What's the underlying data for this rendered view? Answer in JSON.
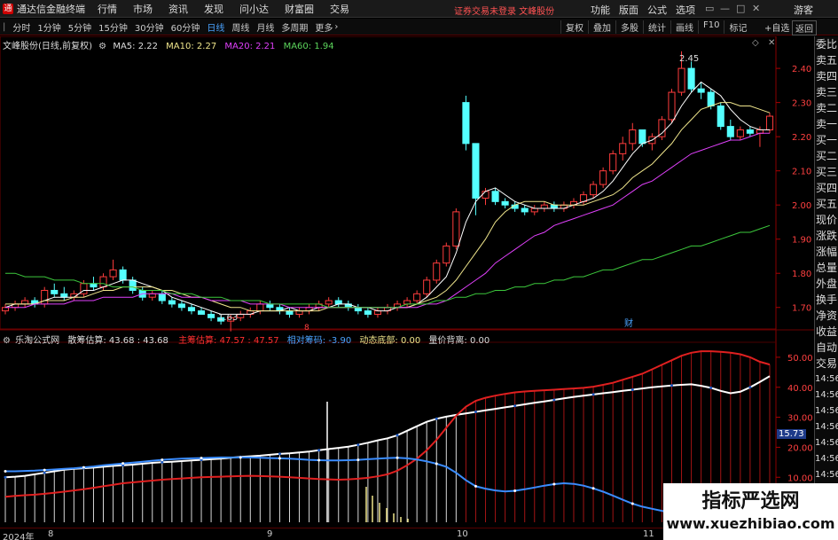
{
  "menubar": {
    "app_title": "通达信金融终端",
    "items": [
      "行情",
      "市场",
      "资讯",
      "发现",
      "问小达",
      "财富圈",
      "交易"
    ],
    "notice": "证券交易未登录  文峰股份",
    "right_items": [
      "功能",
      "版面",
      "公式",
      "选项"
    ],
    "guest": "游客"
  },
  "toolbar": {
    "timeframes": [
      "分时",
      "1分钟",
      "5分钟",
      "15分钟",
      "30分钟",
      "60分钟",
      "日线",
      "周线",
      "月线",
      "多周期",
      "更多"
    ],
    "active": "日线",
    "tools": [
      "复权",
      "叠加",
      "多股",
      "统计",
      "画线",
      "F10",
      "标记"
    ],
    "autoselect": "+自选",
    "back": "返回"
  },
  "main_info": {
    "stock": "文峰股份(日线,前复权)",
    "ma5": "MA5: 2.22",
    "ma10": "MA10: 2.27",
    "ma20": "MA20: 2.21",
    "ma60": "MA60: 1.94"
  },
  "main_annotations": {
    "high": "2.45",
    "low": "1.63",
    "event_8": "8",
    "event_cai": "财"
  },
  "indicator_info": {
    "name": "乐淘公式网",
    "retail_label": "散筹估算: 43.68 : 43.68",
    "main_label": "主筹估算: 47.57 : 47.57",
    "relative_label": "相对筹码: -3.90",
    "bottom_label": "动态底部: 0.00",
    "divergence_label": "量价背离: 0.00"
  },
  "indicator_marker": "15.73",
  "right_panel": [
    "委比",
    "卖五",
    "卖四",
    "卖三",
    "卖二",
    "卖一",
    "买一",
    "买二",
    "买三",
    "买四",
    "买五",
    "现价",
    "涨跌",
    "涨幅",
    "总量",
    "外盘",
    "换手",
    "净资",
    "收益",
    "自动",
    "交易",
    "14:56",
    "14:56",
    "14:56",
    "14:56",
    "14:56",
    "14:56",
    "14:56"
  ],
  "timeline": {
    "year": "2024年",
    "months": [
      "8",
      "9",
      "10",
      "11"
    ]
  },
  "watermark": {
    "title": "指标严选网",
    "url": "www.xuezhibiao.com"
  },
  "chart_data": [
    {
      "type": "candlestick",
      "title": "",
      "y_ticks": [
        "2.40",
        "2.30",
        "2.20",
        "2.10",
        "2.00",
        "1.90",
        "1.80",
        "1.70"
      ],
      "ylim": [
        1.65,
        2.46
      ],
      "ohlc": [
        [
          1.69,
          1.71,
          1.68,
          1.7
        ],
        [
          1.7,
          1.72,
          1.69,
          1.71
        ],
        [
          1.71,
          1.73,
          1.7,
          1.72
        ],
        [
          1.72,
          1.73,
          1.7,
          1.71
        ],
        [
          1.71,
          1.76,
          1.7,
          1.75
        ],
        [
          1.75,
          1.77,
          1.73,
          1.74
        ],
        [
          1.74,
          1.76,
          1.72,
          1.73
        ],
        [
          1.73,
          1.75,
          1.72,
          1.74
        ],
        [
          1.74,
          1.78,
          1.73,
          1.77
        ],
        [
          1.77,
          1.79,
          1.75,
          1.76
        ],
        [
          1.76,
          1.8,
          1.75,
          1.79
        ],
        [
          1.79,
          1.84,
          1.78,
          1.81
        ],
        [
          1.81,
          1.82,
          1.77,
          1.78
        ],
        [
          1.78,
          1.79,
          1.74,
          1.75
        ],
        [
          1.75,
          1.76,
          1.72,
          1.73
        ],
        [
          1.73,
          1.75,
          1.72,
          1.74
        ],
        [
          1.74,
          1.75,
          1.71,
          1.72
        ],
        [
          1.72,
          1.73,
          1.7,
          1.71
        ],
        [
          1.71,
          1.72,
          1.69,
          1.7
        ],
        [
          1.7,
          1.71,
          1.68,
          1.69
        ],
        [
          1.69,
          1.7,
          1.68,
          1.68
        ],
        [
          1.68,
          1.69,
          1.66,
          1.67
        ],
        [
          1.67,
          1.68,
          1.65,
          1.66
        ],
        [
          1.66,
          1.68,
          1.63,
          1.67
        ],
        [
          1.67,
          1.69,
          1.66,
          1.68
        ],
        [
          1.68,
          1.7,
          1.67,
          1.69
        ],
        [
          1.69,
          1.72,
          1.68,
          1.71
        ],
        [
          1.71,
          1.72,
          1.69,
          1.7
        ],
        [
          1.7,
          1.71,
          1.68,
          1.69
        ],
        [
          1.69,
          1.7,
          1.67,
          1.68
        ],
        [
          1.68,
          1.7,
          1.67,
          1.69
        ],
        [
          1.69,
          1.71,
          1.68,
          1.7
        ],
        [
          1.7,
          1.72,
          1.69,
          1.71
        ],
        [
          1.71,
          1.73,
          1.7,
          1.72
        ],
        [
          1.72,
          1.73,
          1.7,
          1.71
        ],
        [
          1.71,
          1.72,
          1.69,
          1.7
        ],
        [
          1.7,
          1.71,
          1.68,
          1.69
        ],
        [
          1.69,
          1.7,
          1.67,
          1.68
        ],
        [
          1.68,
          1.7,
          1.67,
          1.69
        ],
        [
          1.69,
          1.71,
          1.68,
          1.7
        ],
        [
          1.7,
          1.72,
          1.69,
          1.71
        ],
        [
          1.71,
          1.73,
          1.7,
          1.72
        ],
        [
          1.72,
          1.75,
          1.71,
          1.74
        ],
        [
          1.74,
          1.79,
          1.73,
          1.78
        ],
        [
          1.78,
          1.84,
          1.77,
          1.83
        ],
        [
          1.83,
          1.89,
          1.82,
          1.88
        ],
        [
          1.88,
          1.99,
          1.87,
          1.98
        ],
        [
          2.3,
          2.32,
          2.16,
          2.18
        ],
        [
          2.18,
          2.06,
          1.97,
          2.02
        ],
        [
          2.02,
          2.05,
          2.0,
          2.04
        ],
        [
          2.04,
          2.05,
          2.0,
          2.01
        ],
        [
          2.01,
          2.02,
          1.99,
          2.0
        ],
        [
          2.0,
          2.01,
          1.98,
          1.99
        ],
        [
          1.99,
          2.0,
          1.97,
          1.98
        ],
        [
          1.98,
          2.0,
          1.97,
          1.99
        ],
        [
          1.99,
          2.01,
          1.98,
          2.0
        ],
        [
          2.0,
          2.01,
          1.98,
          1.99
        ],
        [
          1.99,
          2.01,
          1.98,
          2.0
        ],
        [
          2.0,
          2.02,
          1.99,
          2.01
        ],
        [
          2.01,
          2.04,
          2.0,
          2.03
        ],
        [
          2.03,
          2.07,
          2.02,
          2.06
        ],
        [
          2.06,
          2.11,
          2.05,
          2.1
        ],
        [
          2.1,
          2.16,
          2.09,
          2.15
        ],
        [
          2.15,
          2.2,
          2.13,
          2.18
        ],
        [
          2.18,
          2.24,
          2.16,
          2.22
        ],
        [
          2.22,
          2.2,
          2.17,
          2.18
        ],
        [
          2.18,
          2.21,
          2.16,
          2.2
        ],
        [
          2.2,
          2.26,
          2.19,
          2.25
        ],
        [
          2.25,
          2.34,
          2.24,
          2.33
        ],
        [
          2.33,
          2.45,
          2.32,
          2.4
        ],
        [
          2.4,
          2.42,
          2.33,
          2.34
        ],
        [
          2.34,
          2.36,
          2.31,
          2.33
        ],
        [
          2.33,
          2.34,
          2.28,
          2.29
        ],
        [
          2.29,
          2.3,
          2.22,
          2.23
        ],
        [
          2.23,
          2.25,
          2.19,
          2.2
        ],
        [
          2.2,
          2.23,
          2.19,
          2.22
        ],
        [
          2.22,
          2.23,
          2.2,
          2.21
        ],
        [
          2.21,
          2.23,
          2.17,
          2.22
        ],
        [
          2.22,
          2.27,
          2.21,
          2.26
        ]
      ],
      "series": [
        {
          "name": "MA5",
          "values": [
            1.7,
            1.71,
            1.71,
            1.71,
            1.72,
            1.73,
            1.73,
            1.73,
            1.75,
            1.75,
            1.76,
            1.77,
            1.78,
            1.78,
            1.77,
            1.76,
            1.75,
            1.73,
            1.72,
            1.71,
            1.7,
            1.69,
            1.68,
            1.68,
            1.68,
            1.68,
            1.69,
            1.69,
            1.69,
            1.7,
            1.69,
            1.69,
            1.7,
            1.7,
            1.71,
            1.71,
            1.7,
            1.7,
            1.69,
            1.69,
            1.7,
            1.7,
            1.71,
            1.73,
            1.76,
            1.79,
            1.86,
            1.95,
            2.01,
            2.04,
            2.05,
            2.03,
            2.01,
            2.0,
            1.99,
            1.99,
            1.99,
            1.99,
            2.0,
            2.01,
            2.02,
            2.04,
            2.07,
            2.11,
            2.15,
            2.18,
            2.19,
            2.21,
            2.24,
            2.29,
            2.33,
            2.36,
            2.34,
            2.32,
            2.28,
            2.25,
            2.23,
            2.22,
            2.22
          ]
        },
        {
          "name": "MA10",
          "values": [
            1.71,
            1.71,
            1.71,
            1.71,
            1.72,
            1.72,
            1.72,
            1.73,
            1.73,
            1.74,
            1.75,
            1.75,
            1.76,
            1.76,
            1.76,
            1.76,
            1.75,
            1.75,
            1.74,
            1.73,
            1.73,
            1.72,
            1.71,
            1.7,
            1.7,
            1.69,
            1.69,
            1.69,
            1.69,
            1.69,
            1.69,
            1.69,
            1.69,
            1.7,
            1.7,
            1.7,
            1.7,
            1.7,
            1.7,
            1.7,
            1.7,
            1.7,
            1.71,
            1.72,
            1.73,
            1.75,
            1.78,
            1.82,
            1.86,
            1.9,
            1.95,
            1.98,
            2.0,
            2.01,
            2.01,
            2.01,
            2.0,
            2.0,
            2.0,
            2.0,
            2.01,
            2.02,
            2.03,
            2.05,
            2.08,
            2.1,
            2.12,
            2.15,
            2.18,
            2.22,
            2.25,
            2.28,
            2.29,
            2.3,
            2.3,
            2.29,
            2.29,
            2.28,
            2.27
          ]
        },
        {
          "name": "MA20",
          "values": [
            1.7,
            1.7,
            1.7,
            1.71,
            1.71,
            1.71,
            1.71,
            1.72,
            1.72,
            1.72,
            1.73,
            1.73,
            1.73,
            1.73,
            1.74,
            1.74,
            1.74,
            1.74,
            1.73,
            1.73,
            1.73,
            1.72,
            1.72,
            1.72,
            1.72,
            1.71,
            1.71,
            1.71,
            1.71,
            1.7,
            1.7,
            1.7,
            1.7,
            1.7,
            1.7,
            1.7,
            1.7,
            1.7,
            1.7,
            1.7,
            1.7,
            1.7,
            1.7,
            1.71,
            1.71,
            1.72,
            1.74,
            1.76,
            1.78,
            1.8,
            1.83,
            1.85,
            1.87,
            1.89,
            1.91,
            1.92,
            1.94,
            1.95,
            1.96,
            1.97,
            1.98,
            1.99,
            2.0,
            2.02,
            2.04,
            2.06,
            2.07,
            2.09,
            2.11,
            2.13,
            2.15,
            2.16,
            2.17,
            2.18,
            2.19,
            2.19,
            2.2,
            2.21,
            2.21
          ]
        },
        {
          "name": "MA60",
          "values": [
            1.8,
            1.8,
            1.79,
            1.79,
            1.79,
            1.78,
            1.78,
            1.78,
            1.77,
            1.77,
            1.77,
            1.76,
            1.76,
            1.76,
            1.75,
            1.75,
            1.75,
            1.74,
            1.74,
            1.74,
            1.73,
            1.73,
            1.73,
            1.72,
            1.72,
            1.72,
            1.72,
            1.71,
            1.71,
            1.71,
            1.71,
            1.71,
            1.71,
            1.7,
            1.7,
            1.7,
            1.7,
            1.7,
            1.7,
            1.7,
            1.7,
            1.71,
            1.71,
            1.71,
            1.72,
            1.72,
            1.73,
            1.73,
            1.74,
            1.74,
            1.75,
            1.75,
            1.76,
            1.76,
            1.77,
            1.77,
            1.78,
            1.78,
            1.79,
            1.79,
            1.8,
            1.81,
            1.81,
            1.82,
            1.83,
            1.84,
            1.84,
            1.85,
            1.86,
            1.87,
            1.88,
            1.88,
            1.89,
            1.9,
            1.91,
            1.92,
            1.92,
            1.93,
            1.94
          ]
        }
      ]
    },
    {
      "type": "line",
      "title": "",
      "y_ticks": [
        "50.00",
        "40.00",
        "30.00",
        "20.00",
        "10.00"
      ],
      "ylim": [
        -5,
        55
      ],
      "series": [
        {
          "name": "散筹估算",
          "values": [
            10.0,
            10.2,
            10.5,
            11.0,
            11.5,
            12.0,
            12.5,
            12.8,
            13.0,
            13.2,
            13.5,
            13.8,
            14.0,
            14.2,
            14.5,
            14.8,
            15.0,
            15.2,
            15.4,
            15.6,
            15.8,
            16.0,
            16.2,
            16.5,
            16.8,
            17.0,
            17.2,
            17.5,
            17.8,
            18.0,
            18.3,
            18.6,
            19.0,
            19.4,
            19.8,
            20.2,
            20.8,
            21.5,
            22.3,
            23.0,
            24.0,
            25.5,
            27.0,
            28.5,
            29.5,
            30.2,
            30.8,
            31.3,
            31.8,
            32.3,
            32.8,
            33.3,
            33.8,
            34.3,
            34.8,
            35.3,
            35.8,
            36.3,
            36.8,
            37.2,
            37.6,
            38.0,
            38.4,
            38.8,
            39.2,
            39.6,
            40.0,
            40.3,
            40.6,
            40.8,
            41.0,
            40.5,
            39.8,
            38.8,
            38.0,
            38.5,
            40.0,
            41.8,
            43.68
          ]
        },
        {
          "name": "主筹估算",
          "values": [
            3.5,
            3.8,
            4.0,
            4.2,
            4.5,
            4.8,
            5.2,
            5.6,
            6.0,
            6.5,
            7.0,
            7.5,
            8.0,
            8.3,
            8.6,
            8.9,
            9.2,
            9.4,
            9.6,
            9.8,
            10.0,
            10.1,
            10.2,
            10.3,
            10.4,
            10.5,
            10.4,
            10.3,
            10.2,
            10.0,
            9.8,
            9.6,
            9.4,
            9.3,
            9.2,
            9.3,
            9.5,
            9.8,
            10.3,
            11.0,
            12.2,
            14.0,
            16.2,
            19.0,
            22.5,
            26.5,
            30.5,
            33.5,
            35.5,
            36.5,
            37.2,
            37.8,
            38.3,
            38.6,
            38.8,
            39.0,
            39.2,
            39.4,
            39.6,
            39.8,
            40.2,
            40.8,
            41.5,
            42.5,
            43.5,
            44.5,
            46.0,
            47.5,
            49.0,
            50.5,
            51.5,
            52.0,
            52.0,
            51.8,
            51.5,
            51.0,
            50.0,
            48.5,
            47.57
          ]
        },
        {
          "name": "相对筹码",
          "values": [
            12.0,
            12.0,
            12.1,
            12.2,
            12.4,
            12.6,
            12.8,
            13.0,
            13.3,
            13.6,
            14.0,
            14.3,
            14.6,
            14.9,
            15.2,
            15.5,
            15.8,
            16.0,
            16.2,
            16.3,
            16.4,
            16.5,
            16.6,
            16.6,
            16.6,
            16.6,
            16.5,
            16.4,
            16.3,
            16.2,
            16.0,
            15.8,
            15.7,
            15.6,
            15.6,
            15.7,
            15.8,
            16.0,
            16.2,
            16.4,
            16.5,
            16.3,
            15.9,
            15.3,
            14.5,
            13.5,
            11.5,
            9.0,
            7.0,
            6.2,
            5.6,
            5.3,
            5.5,
            6.0,
            6.6,
            7.2,
            7.7,
            8.0,
            7.8,
            7.2,
            6.3,
            5.2,
            3.9,
            2.5,
            1.2,
            0.2,
            -0.5,
            -1.2,
            -1.8,
            -2.4,
            -3.0,
            -3.3,
            -3.5,
            -3.6,
            -3.7,
            -3.8,
            -3.9,
            -3.9,
            -3.9
          ]
        }
      ]
    }
  ]
}
